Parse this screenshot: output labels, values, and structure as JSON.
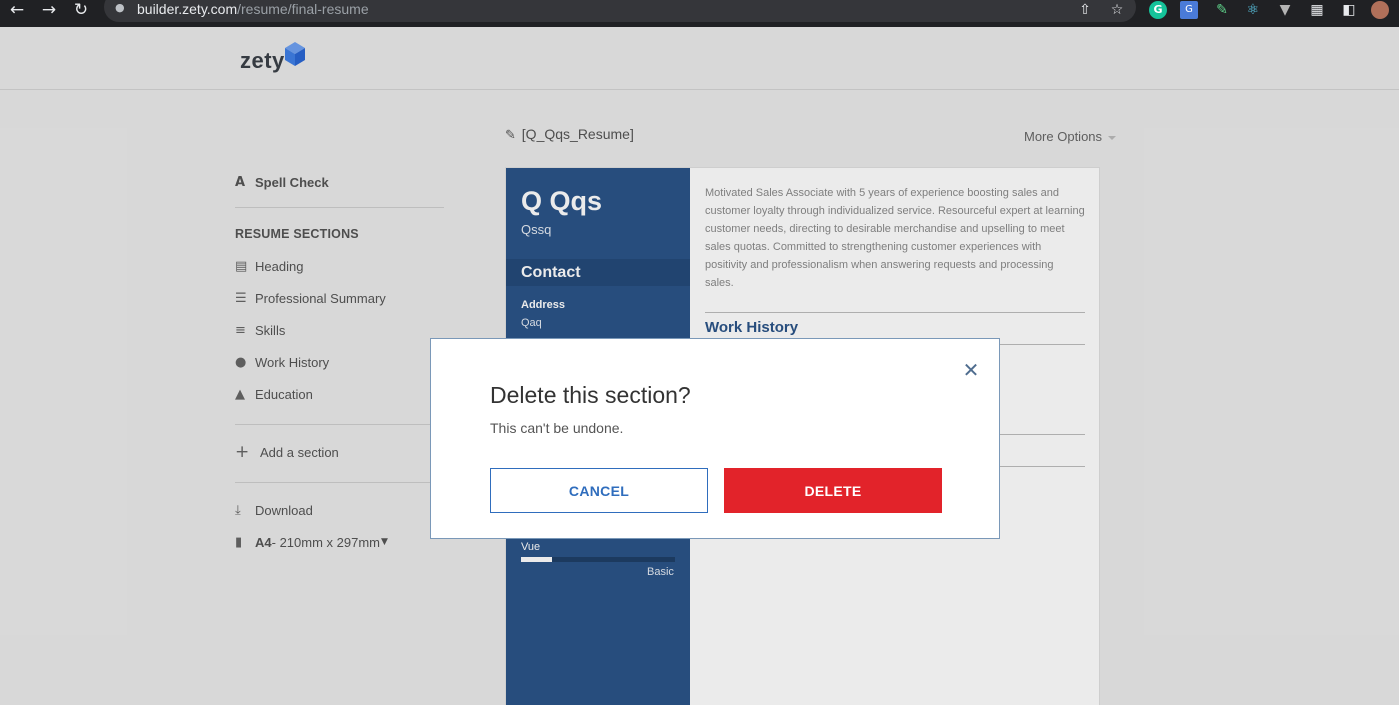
{
  "browser": {
    "url_host": "builder.zety.com",
    "url_path": "/resume/final-resume",
    "back_icon": "arrow-left-icon",
    "forward_icon": "arrow-right-icon",
    "reload_icon": "reload-icon",
    "lock_icon": "lock-icon"
  },
  "header": {
    "logo_text": "zety"
  },
  "sidebar": {
    "spell_check": "Spell Check",
    "sections_heading": "RESUME SECTIONS",
    "items": [
      {
        "label": "Heading",
        "icon": "document-icon"
      },
      {
        "label": "Professional Summary",
        "icon": "lines-icon"
      },
      {
        "label": "Skills",
        "icon": "list-icon"
      },
      {
        "label": "Work History",
        "icon": "users-icon"
      },
      {
        "label": "Education",
        "icon": "graduation-cap-icon"
      }
    ],
    "add_section": "Add a section",
    "download": "Download",
    "page_size_bold": "A4",
    "page_size_rest": " - 210mm x 297mm"
  },
  "document": {
    "title": "[Q_Qqs_Resume]",
    "more_options": "More Options"
  },
  "resume": {
    "name": "Q Qqs",
    "subtitle": "Qssq",
    "contact_heading": "Contact",
    "address_label": "Address",
    "address_value": "Qaq",
    "summary": "Motivated Sales Associate with 5 years of experience boosting sales and customer loyalty through individualized service. Resourceful expert at learning customer needs, directing to desirable merchandise and upselling to meet sales quotas. Committed to strengthening customer experiences with positivity and professionalism when answering requests and processing sales.",
    "work_history_heading": "Work History",
    "skill": {
      "name": "Vue",
      "level_label": "Basic",
      "level_fraction": 0.2
    }
  },
  "modal": {
    "title": "Delete this section?",
    "subtitle": "This can't be undone.",
    "cancel_label": "CANCEL",
    "delete_label": "DELETE"
  },
  "colors": {
    "resume_sidebar": "#2b5488",
    "delete_button": "#e2232a",
    "cancel_border": "#2f6dbd"
  }
}
